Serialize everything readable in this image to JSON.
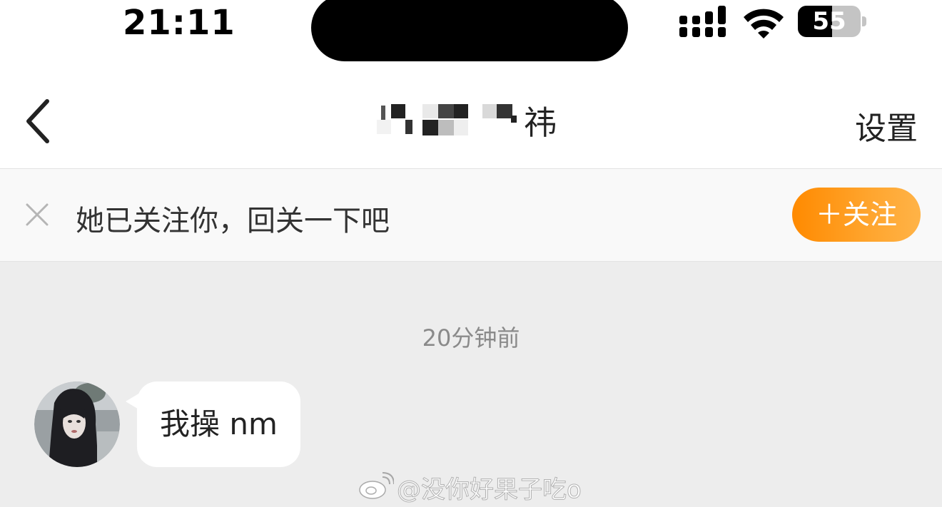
{
  "status_bar": {
    "time": "21:11",
    "battery_level": "55",
    "battery_fraction": 0.55,
    "signal_icon": "cellular-signal-icon",
    "wifi_icon": "wifi-icon",
    "battery_icon": "battery-icon"
  },
  "nav": {
    "back_icon": "chevron-left-icon",
    "title_visible": "祎",
    "settings_label": "设置"
  },
  "follow_banner": {
    "dismiss_icon": "close-icon",
    "text": "她已关注你，回关一下吧",
    "follow_label": "＋关注"
  },
  "chat": {
    "timestamp": "20分钟前",
    "messages": [
      {
        "sender": "other",
        "text": "我操 nm"
      }
    ]
  },
  "watermark": {
    "text": "@没你好果子吃o"
  },
  "colors": {
    "accent_orange": "#ff8a00",
    "chat_background": "#ededed",
    "bubble_background": "#ffffff",
    "timestamp_gray": "#8a8a8a"
  }
}
